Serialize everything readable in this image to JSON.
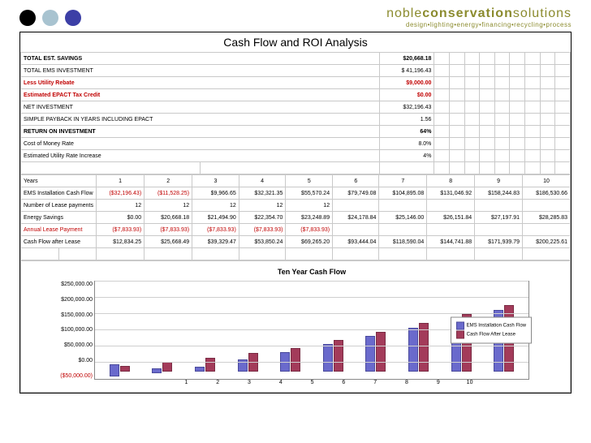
{
  "brand": {
    "noble": "noble",
    "cons": "conservation",
    "sol": "solutions",
    "sub": "design•lighting•energy•financing•recycling•process"
  },
  "title": "Cash Flow and ROI Analysis",
  "summary": [
    {
      "label": "TOTAL EST. SAVINGS",
      "value": "$20,668.18",
      "bold": true
    },
    {
      "label": "TOTAL EMS INVESTMENT",
      "value": "$    41,196.43"
    },
    {
      "label": "Less Utility Rebate",
      "value": "$9,000.00",
      "red": true,
      "bold": true
    },
    {
      "label": "Estimated EPACT Tax Credit",
      "value": "$0.00",
      "red": true,
      "bold": true
    },
    {
      "label": "NET INVESTMENT",
      "value": "$32,196.43"
    },
    {
      "label": "SIMPLE PAYBACK IN YEARS INCLUDING EPACT",
      "value": "1.56"
    },
    {
      "label": "RETURN ON INVESTMENT",
      "value": "64%",
      "bold": true
    },
    {
      "label": "Cost of Money Rate",
      "value": "8.0%"
    },
    {
      "label": "Estimated Utility Rate Increase",
      "value": "4%"
    }
  ],
  "years_label": "Years",
  "years": [
    "1",
    "2",
    "3",
    "4",
    "5",
    "6",
    "7",
    "8",
    "9",
    "10"
  ],
  "rows": [
    {
      "label": "EMS Installation Cash Flow",
      "vals": [
        "($32,196.43)",
        "($11,528.25)",
        "$9,966.65",
        "$32,321.35",
        "$55,570.24",
        "$79,749.08",
        "$104,895.08",
        "$131,046.92",
        "$158,244.83",
        "$186,530.66"
      ]
    },
    {
      "label": "Number of Lease payments",
      "vals": [
        "12",
        "12",
        "12",
        "12",
        "12",
        "",
        "",
        "",
        "",
        ""
      ]
    },
    {
      "label": "Energy Savings",
      "vals": [
        "$0.00",
        "$20,668.18",
        "$21,494.90",
        "$22,354.70",
        "$23,248.89",
        "$24,178.84",
        "$25,146.00",
        "$26,151.84",
        "$27,197.91",
        "$28,285.83"
      ]
    },
    {
      "label": "Annual Lease Payment",
      "vals": [
        "($7,833.93)",
        "($7,833.93)",
        "($7,833.93)",
        "($7,833.93)",
        "($7,833.93)",
        "",
        "",
        "",
        "",
        ""
      ],
      "red": true
    },
    {
      "label": "Cash Flow after Lease",
      "vals": [
        "$12,834.25",
        "$25,668.49",
        "$39,329.47",
        "$53,850.24",
        "$69,265.20",
        "$93,444.04",
        "$118,590.04",
        "$144,741.88",
        "$171,939.79",
        "$200,225.61"
      ]
    }
  ],
  "chart_data": {
    "type": "bar",
    "title": "Ten Year Cash Flow",
    "categories": [
      "1",
      "2",
      "3",
      "4",
      "5",
      "6",
      "7",
      "8",
      "9",
      "10"
    ],
    "series": [
      {
        "name": "EMS Installation Cash Flow",
        "color": "#6a6acc",
        "values": [
          -32196.43,
          -11528.25,
          9966.65,
          32321.35,
          55570.24,
          79749.08,
          104895.08,
          131046.92,
          158244.83,
          186530.66
        ]
      },
      {
        "name": "Cash Flow After Lease",
        "color": "#a33b5a",
        "values": [
          12834.25,
          25668.49,
          39329.47,
          53850.24,
          69265.2,
          93444.04,
          118590.04,
          144741.88,
          171939.79,
          200225.61
        ]
      }
    ],
    "ylim": [
      -50000,
      250000
    ],
    "yticks": [
      "$250,000.00",
      "$200,000.00",
      "$150,000.00",
      "$100,000.00",
      "$50,000.00",
      "$0.00",
      "($50,000.00)"
    ]
  }
}
